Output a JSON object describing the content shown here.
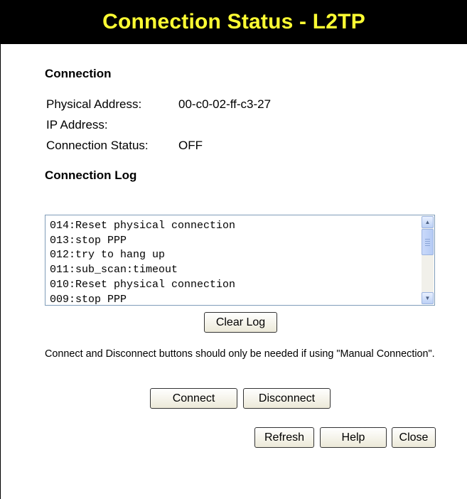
{
  "header": {
    "title": "Connection Status - L2TP",
    "background": "#000000",
    "title_color": "#ffff33"
  },
  "connection": {
    "heading": "Connection",
    "fields": [
      {
        "label": "Physical Address:",
        "value": "00-c0-02-ff-c3-27"
      },
      {
        "label": "IP Address:",
        "value": ""
      },
      {
        "label": "Connection Status:",
        "value": "OFF"
      }
    ]
  },
  "log": {
    "heading": "Connection Log",
    "lines": [
      "014:Reset physical connection",
      "013:stop PPP",
      "012:try to hang up",
      "011:sub_scan:timeout",
      "010:Reset physical connection",
      "009:stop PPP"
    ],
    "scroll_up_icon": "chevron-up",
    "scroll_down_icon": "chevron-down",
    "clear_label": "Clear Log"
  },
  "note": "Connect and Disconnect buttons should only be needed if using \"Manual Connection\".",
  "actions": {
    "connect_label": "Connect",
    "disconnect_label": "Disconnect"
  },
  "footer": {
    "refresh_label": "Refresh",
    "help_label": "Help",
    "close_label": "Close"
  }
}
